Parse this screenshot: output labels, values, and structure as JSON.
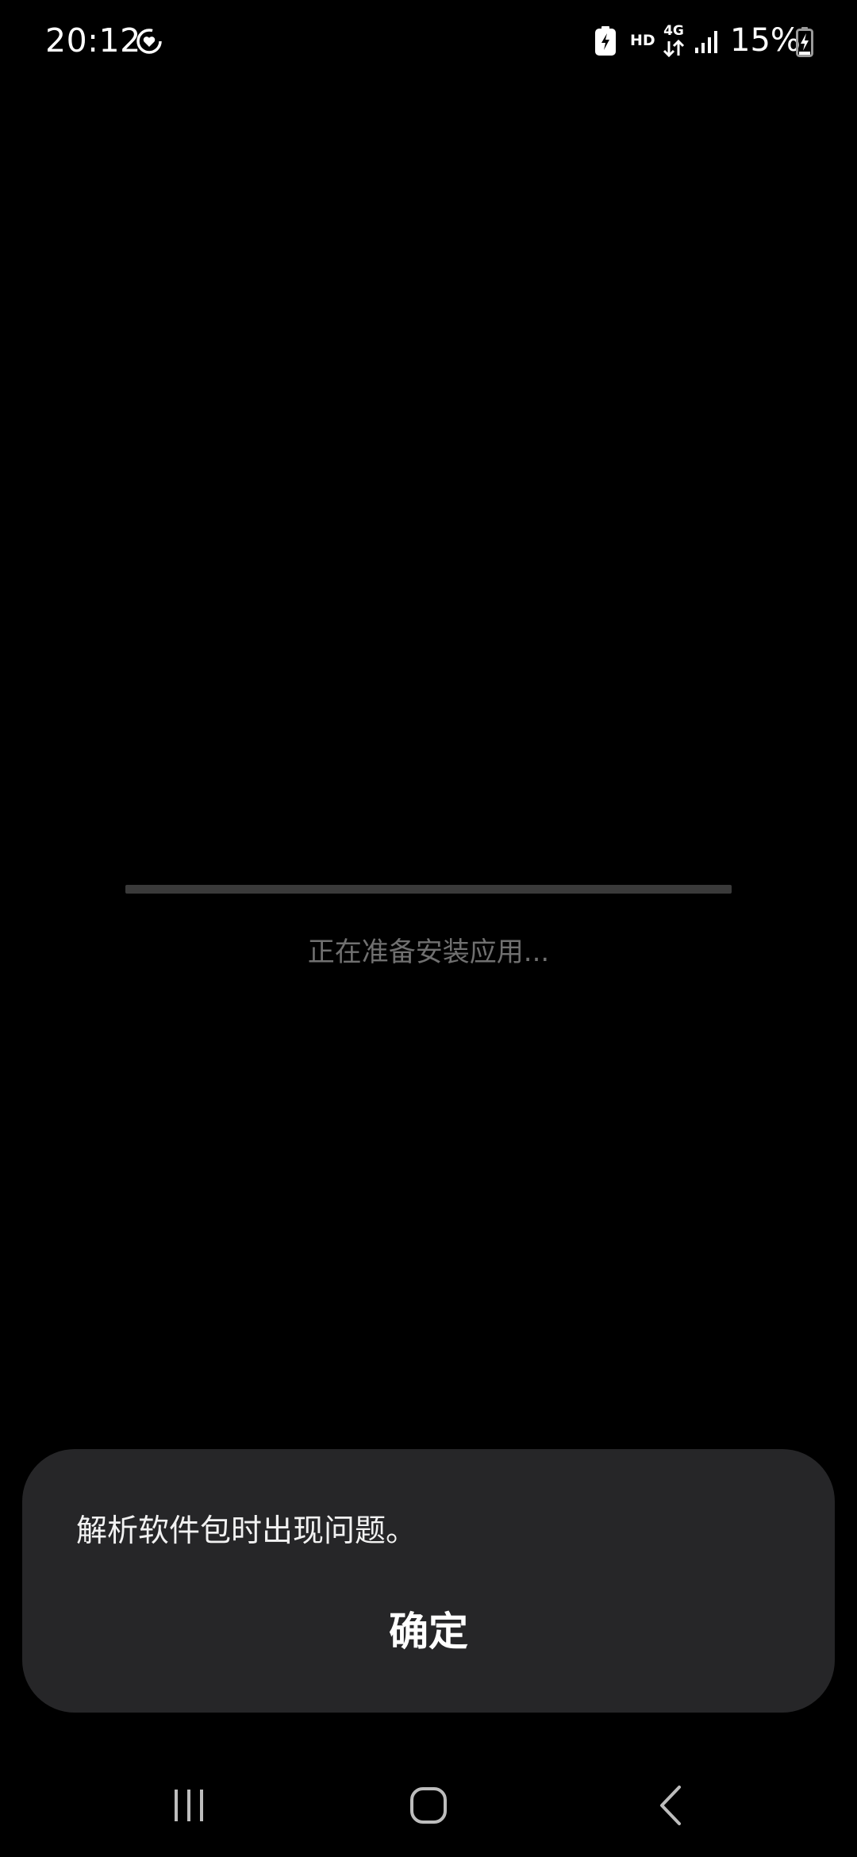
{
  "status_bar": {
    "time": "20:12",
    "sync_icon": "sync-heart-icon",
    "battery_saver_icon": "battery-saver-icon",
    "hd_label": "HD",
    "network_label": "4G",
    "signal_icon": "cellular-signal-icon",
    "battery_percent": "15%",
    "battery_icon": "battery-charging-icon"
  },
  "installer": {
    "progress": 0,
    "status_text": "正在准备安装应用..."
  },
  "dialog": {
    "message": "解析软件包时出现问题。",
    "ok_label": "确定"
  },
  "nav_bar": {
    "recents_icon": "recent-apps-icon",
    "home_icon": "home-icon",
    "back_icon": "back-icon"
  },
  "colors": {
    "background": "#000000",
    "dialog_background": "#262628",
    "status_text": "#707070",
    "progress_track": "#3a3a3a"
  }
}
